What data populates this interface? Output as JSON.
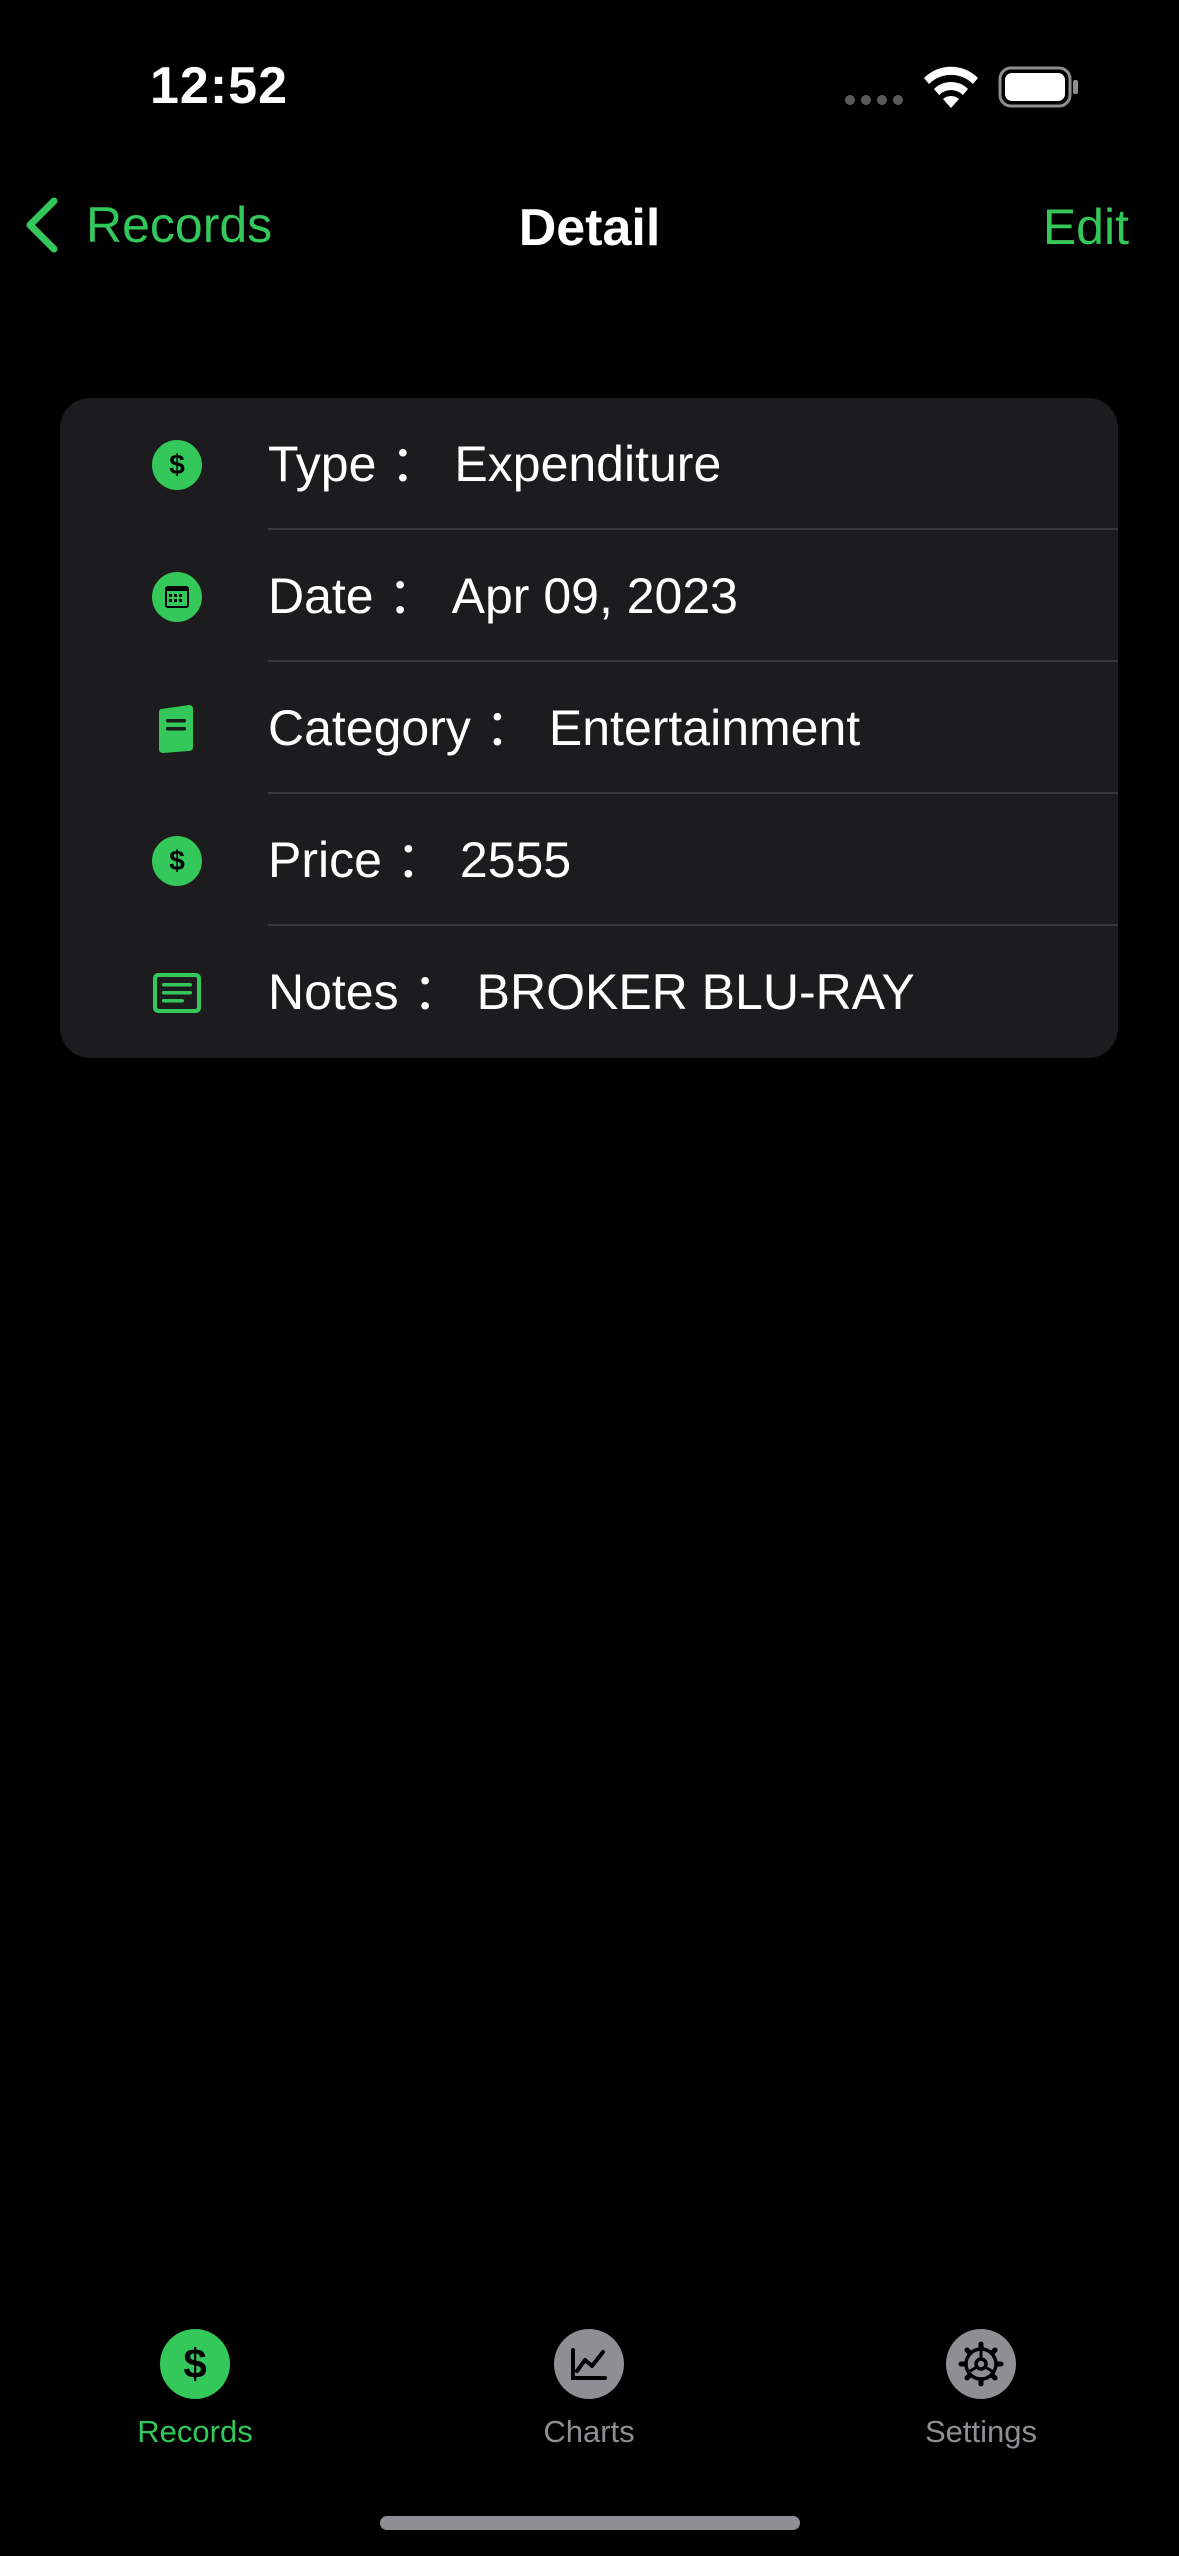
{
  "status_bar": {
    "time": "12:52"
  },
  "nav": {
    "back_label": "Records",
    "title": "Detail",
    "edit_label": "Edit"
  },
  "detail": {
    "separator": "：",
    "rows": [
      {
        "label": "Type",
        "value": "Expenditure",
        "icon": "dollar-circle-icon"
      },
      {
        "label": "Date",
        "value": "Apr 09, 2023",
        "icon": "calendar-circle-icon"
      },
      {
        "label": "Category",
        "value": "Entertainment",
        "icon": "document-icon"
      },
      {
        "label": "Price",
        "value": "2555",
        "icon": "dollar-circle-icon"
      },
      {
        "label": "Notes",
        "value": "BROKER BLU-RAY",
        "icon": "note-icon"
      }
    ]
  },
  "tabs": [
    {
      "label": "Records",
      "icon": "dollar-circle-icon",
      "selected": true
    },
    {
      "label": "Charts",
      "icon": "chart-circle-icon",
      "selected": false
    },
    {
      "label": "Settings",
      "icon": "gear-circle-icon",
      "selected": false
    }
  ],
  "colors": {
    "accent": "#34c759",
    "background": "#000000",
    "card": "#1c1c1e",
    "divider": "#38383a",
    "inactive": "#8e8e93"
  }
}
